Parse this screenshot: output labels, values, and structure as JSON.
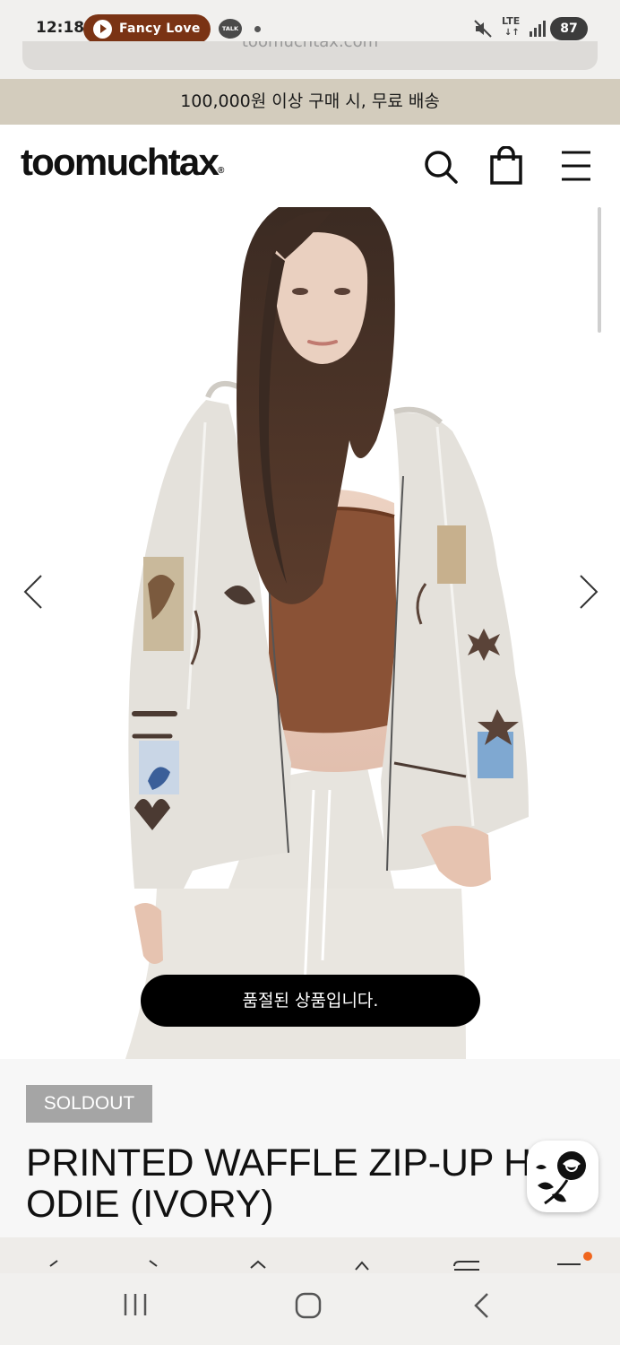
{
  "status_bar": {
    "time": "12:18",
    "notification_pill": "Fancy Love",
    "talk_icon_text": "TALK",
    "network": "LTE",
    "network_arrows": "↓↑",
    "battery": "87",
    "icons": [
      "play-icon",
      "talk-icon",
      "mute-icon",
      "signal-icon",
      "battery-icon"
    ]
  },
  "url_bar": {
    "url": "toomuchtax.com"
  },
  "promo_banner": {
    "text": "100,000원 이상 구매 시, 무료 배송"
  },
  "header": {
    "logo": "toomuchtax",
    "logo_mark": "®",
    "icons": [
      "search-icon",
      "shopping-bag-icon",
      "menu-icon"
    ]
  },
  "hero": {
    "slider_icons": [
      "chevron-left-icon",
      "chevron-right-icon"
    ],
    "toast": "품절된 상품입니다."
  },
  "product": {
    "badge": "SOLDOUT",
    "title_line1": "PRINTED WAFFLE ZIP-UP H",
    "title_line2": "ODIE (IVORY)"
  },
  "browser_toolbar": {
    "icons": [
      "back-icon",
      "forward-icon",
      "home-icon",
      "bookmark-icon",
      "tabs-icon",
      "menu-icon"
    ],
    "accent": "#f0661e"
  },
  "android_nav": {
    "icons": [
      "recents-icon",
      "home-icon",
      "back-icon"
    ]
  },
  "colors": {
    "promo_bg": "#d3ccbd",
    "notification_pill": "#7a3314",
    "badge_bg": "#a5a5a5",
    "toast_bg": "#000000"
  }
}
